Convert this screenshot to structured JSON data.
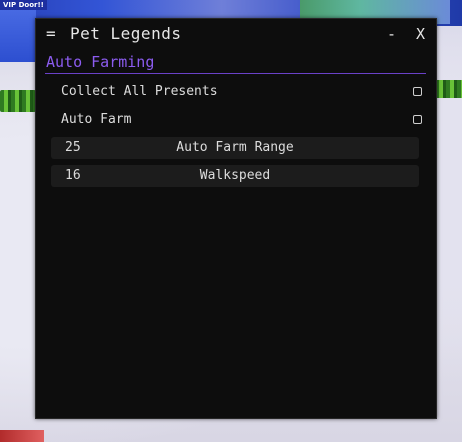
{
  "background": {
    "sign_text": "VIP Door!!"
  },
  "window": {
    "menu_icon": "=",
    "title": "Pet Legends",
    "minimize_label": "-",
    "close_label": "X"
  },
  "section": {
    "title": "Auto Farming",
    "accent_color": "#8c5cf0"
  },
  "toggles": [
    {
      "label": "Collect All Presents",
      "checked": false
    },
    {
      "label": "Auto Farm",
      "checked": false
    }
  ],
  "sliders": [
    {
      "value": "25",
      "label": "Auto Farm Range"
    },
    {
      "value": "16",
      "label": "Walkspeed"
    }
  ]
}
